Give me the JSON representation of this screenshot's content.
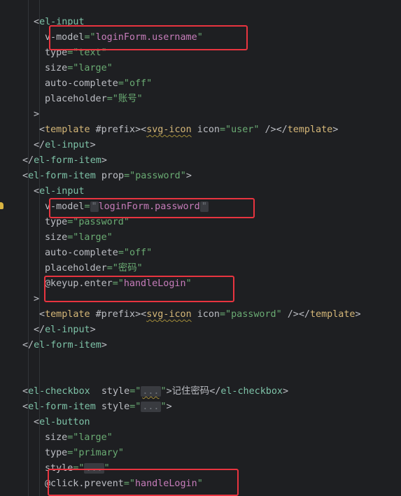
{
  "lines": [
    {
      "indent": 1,
      "tokens": [
        [
          "<",
          "punct"
        ],
        [
          "el-input",
          "tag"
        ]
      ]
    },
    {
      "indent": 2,
      "tokens": [
        [
          "v-model",
          "attr"
        ],
        [
          "=\"",
          "str"
        ],
        [
          "loginForm.username",
          "str2"
        ],
        [
          "\"",
          "str"
        ]
      ]
    },
    {
      "indent": 2,
      "tokens": [
        [
          "type",
          "attr"
        ],
        [
          "=\"",
          "str"
        ],
        [
          "text",
          "str"
        ],
        [
          "\"",
          "str"
        ]
      ]
    },
    {
      "indent": 2,
      "tokens": [
        [
          "size",
          "attr"
        ],
        [
          "=\"",
          "str"
        ],
        [
          "large",
          "str"
        ],
        [
          "\"",
          "str"
        ]
      ]
    },
    {
      "indent": 2,
      "tokens": [
        [
          "auto-complete",
          "attr"
        ],
        [
          "=\"",
          "str"
        ],
        [
          "off",
          "str"
        ],
        [
          "\"",
          "str"
        ]
      ]
    },
    {
      "indent": 2,
      "tokens": [
        [
          "placeholder",
          "attr"
        ],
        [
          "=\"",
          "str"
        ],
        [
          "账号",
          "str"
        ],
        [
          "\"",
          "str"
        ]
      ]
    },
    {
      "indent": 1,
      "tokens": [
        [
          ">",
          "punct"
        ]
      ]
    },
    {
      "indent": 1.5,
      "tokens": [
        [
          "<",
          "punct"
        ],
        [
          "template",
          "tag2"
        ],
        [
          " #prefix",
          "attr"
        ],
        [
          ">",
          "punct"
        ],
        [
          "<",
          "punct"
        ],
        [
          "svg-icon",
          "tag2w"
        ],
        [
          " icon",
          "attr"
        ],
        [
          "=\"",
          "str"
        ],
        [
          "user",
          "str"
        ],
        [
          "\"",
          "str"
        ],
        [
          " />",
          "punct"
        ],
        [
          "</",
          "punct"
        ],
        [
          "template",
          "tag2"
        ],
        [
          ">",
          "punct"
        ]
      ]
    },
    {
      "indent": 1,
      "tokens": [
        [
          "</",
          "punct"
        ],
        [
          "el-input",
          "tag"
        ],
        [
          ">",
          "punct"
        ]
      ]
    },
    {
      "indent": 0,
      "tokens": [
        [
          "</",
          "punct"
        ],
        [
          "el-form-item",
          "tag"
        ],
        [
          ">",
          "punct"
        ]
      ]
    },
    {
      "indent": 0,
      "tokens": [
        [
          "<",
          "punct"
        ],
        [
          "el-form-item",
          "tag"
        ],
        [
          " prop",
          "attr"
        ],
        [
          "=\"",
          "str"
        ],
        [
          "password",
          "str"
        ],
        [
          "\"",
          "str"
        ],
        [
          ">",
          "punct"
        ]
      ]
    },
    {
      "indent": 1,
      "tokens": [
        [
          "<",
          "punct"
        ],
        [
          "el-input",
          "tag"
        ]
      ]
    },
    {
      "indent": 2,
      "tokens": [
        [
          "v-model",
          "attr"
        ],
        [
          "=",
          "str"
        ],
        [
          "\"",
          "fold"
        ],
        [
          "loginForm.password",
          "str2"
        ],
        [
          "\"",
          "fold"
        ]
      ]
    },
    {
      "indent": 2,
      "tokens": [
        [
          "type",
          "attr"
        ],
        [
          "=\"",
          "str"
        ],
        [
          "password",
          "str"
        ],
        [
          "\"",
          "str"
        ]
      ]
    },
    {
      "indent": 2,
      "tokens": [
        [
          "size",
          "attr"
        ],
        [
          "=\"",
          "str"
        ],
        [
          "large",
          "str"
        ],
        [
          "\"",
          "str"
        ]
      ]
    },
    {
      "indent": 2,
      "tokens": [
        [
          "auto-complete",
          "attr"
        ],
        [
          "=\"",
          "str"
        ],
        [
          "off",
          "str"
        ],
        [
          "\"",
          "str"
        ]
      ]
    },
    {
      "indent": 2,
      "tokens": [
        [
          "placeholder",
          "attr"
        ],
        [
          "=\"",
          "str"
        ],
        [
          "密码",
          "str"
        ],
        [
          "\"",
          "str"
        ]
      ]
    },
    {
      "indent": 2,
      "tokens": [
        [
          "@keyup.enter",
          "attr"
        ],
        [
          "=\"",
          "str"
        ],
        [
          "handleLogin",
          "str2"
        ],
        [
          "\"",
          "str"
        ]
      ]
    },
    {
      "indent": 1,
      "tokens": [
        [
          ">",
          "punct"
        ]
      ]
    },
    {
      "indent": 1.5,
      "tokens": [
        [
          "<",
          "punct"
        ],
        [
          "template",
          "tag2"
        ],
        [
          " #prefix",
          "attr"
        ],
        [
          ">",
          "punct"
        ],
        [
          "<",
          "punct"
        ],
        [
          "svg-icon",
          "tag2w"
        ],
        [
          " icon",
          "attr"
        ],
        [
          "=\"",
          "str"
        ],
        [
          "password",
          "str"
        ],
        [
          "\"",
          "str"
        ],
        [
          " />",
          "punct"
        ],
        [
          "</",
          "punct"
        ],
        [
          "template",
          "tag2"
        ],
        [
          ">",
          "punct"
        ]
      ]
    },
    {
      "indent": 1,
      "tokens": [
        [
          "</",
          "punct"
        ],
        [
          "el-input",
          "tag"
        ],
        [
          ">",
          "punct"
        ]
      ]
    },
    {
      "indent": 0,
      "tokens": [
        [
          "</",
          "punct"
        ],
        [
          "el-form-item",
          "tag"
        ],
        [
          ">",
          "punct"
        ]
      ]
    },
    {
      "indent": 0,
      "tokens": []
    },
    {
      "indent": 0,
      "tokens": []
    },
    {
      "indent": 0,
      "tokens": [
        [
          "<",
          "punct"
        ],
        [
          "el-checkbox",
          "tag"
        ],
        [
          "  style",
          "attr"
        ],
        [
          "=\"",
          "str"
        ],
        [
          "...",
          "foldw"
        ],
        [
          "\"",
          "str"
        ],
        [
          ">",
          "punct"
        ],
        [
          "记住密码",
          "text"
        ],
        [
          "</",
          "punct"
        ],
        [
          "el-checkbox",
          "tag"
        ],
        [
          ">",
          "punct"
        ]
      ]
    },
    {
      "indent": 0,
      "tokens": [
        [
          "<",
          "punct"
        ],
        [
          "el-form-item",
          "tag"
        ],
        [
          " style",
          "attr"
        ],
        [
          "=\"",
          "str"
        ],
        [
          "...",
          "fold"
        ],
        [
          "\"",
          "str"
        ],
        [
          ">",
          "punct"
        ]
      ]
    },
    {
      "indent": 1,
      "tokens": [
        [
          "<",
          "punct"
        ],
        [
          "el-button",
          "tag"
        ]
      ]
    },
    {
      "indent": 2,
      "tokens": [
        [
          "size",
          "attr"
        ],
        [
          "=\"",
          "str"
        ],
        [
          "large",
          "str"
        ],
        [
          "\"",
          "str"
        ]
      ]
    },
    {
      "indent": 2,
      "tokens": [
        [
          "type",
          "attr"
        ],
        [
          "=\"",
          "str"
        ],
        [
          "primary",
          "str"
        ],
        [
          "\"",
          "str"
        ]
      ]
    },
    {
      "indent": 2,
      "tokens": [
        [
          "style",
          "attr"
        ],
        [
          "=\"",
          "str"
        ],
        [
          "...",
          "fold"
        ],
        [
          "\"",
          "str"
        ]
      ]
    },
    {
      "indent": 2,
      "tokens": [
        [
          "@click.prevent",
          "attr"
        ],
        [
          "=\"",
          "str"
        ],
        [
          "handleLogin",
          "str2"
        ],
        [
          "\"",
          "str"
        ]
      ]
    }
  ],
  "colors": {
    "background": "#1e1f22",
    "tag": "#7ec3a8",
    "string": "#6aab73",
    "string_accent": "#c77dbb",
    "highlight_box": "#e8343f"
  }
}
